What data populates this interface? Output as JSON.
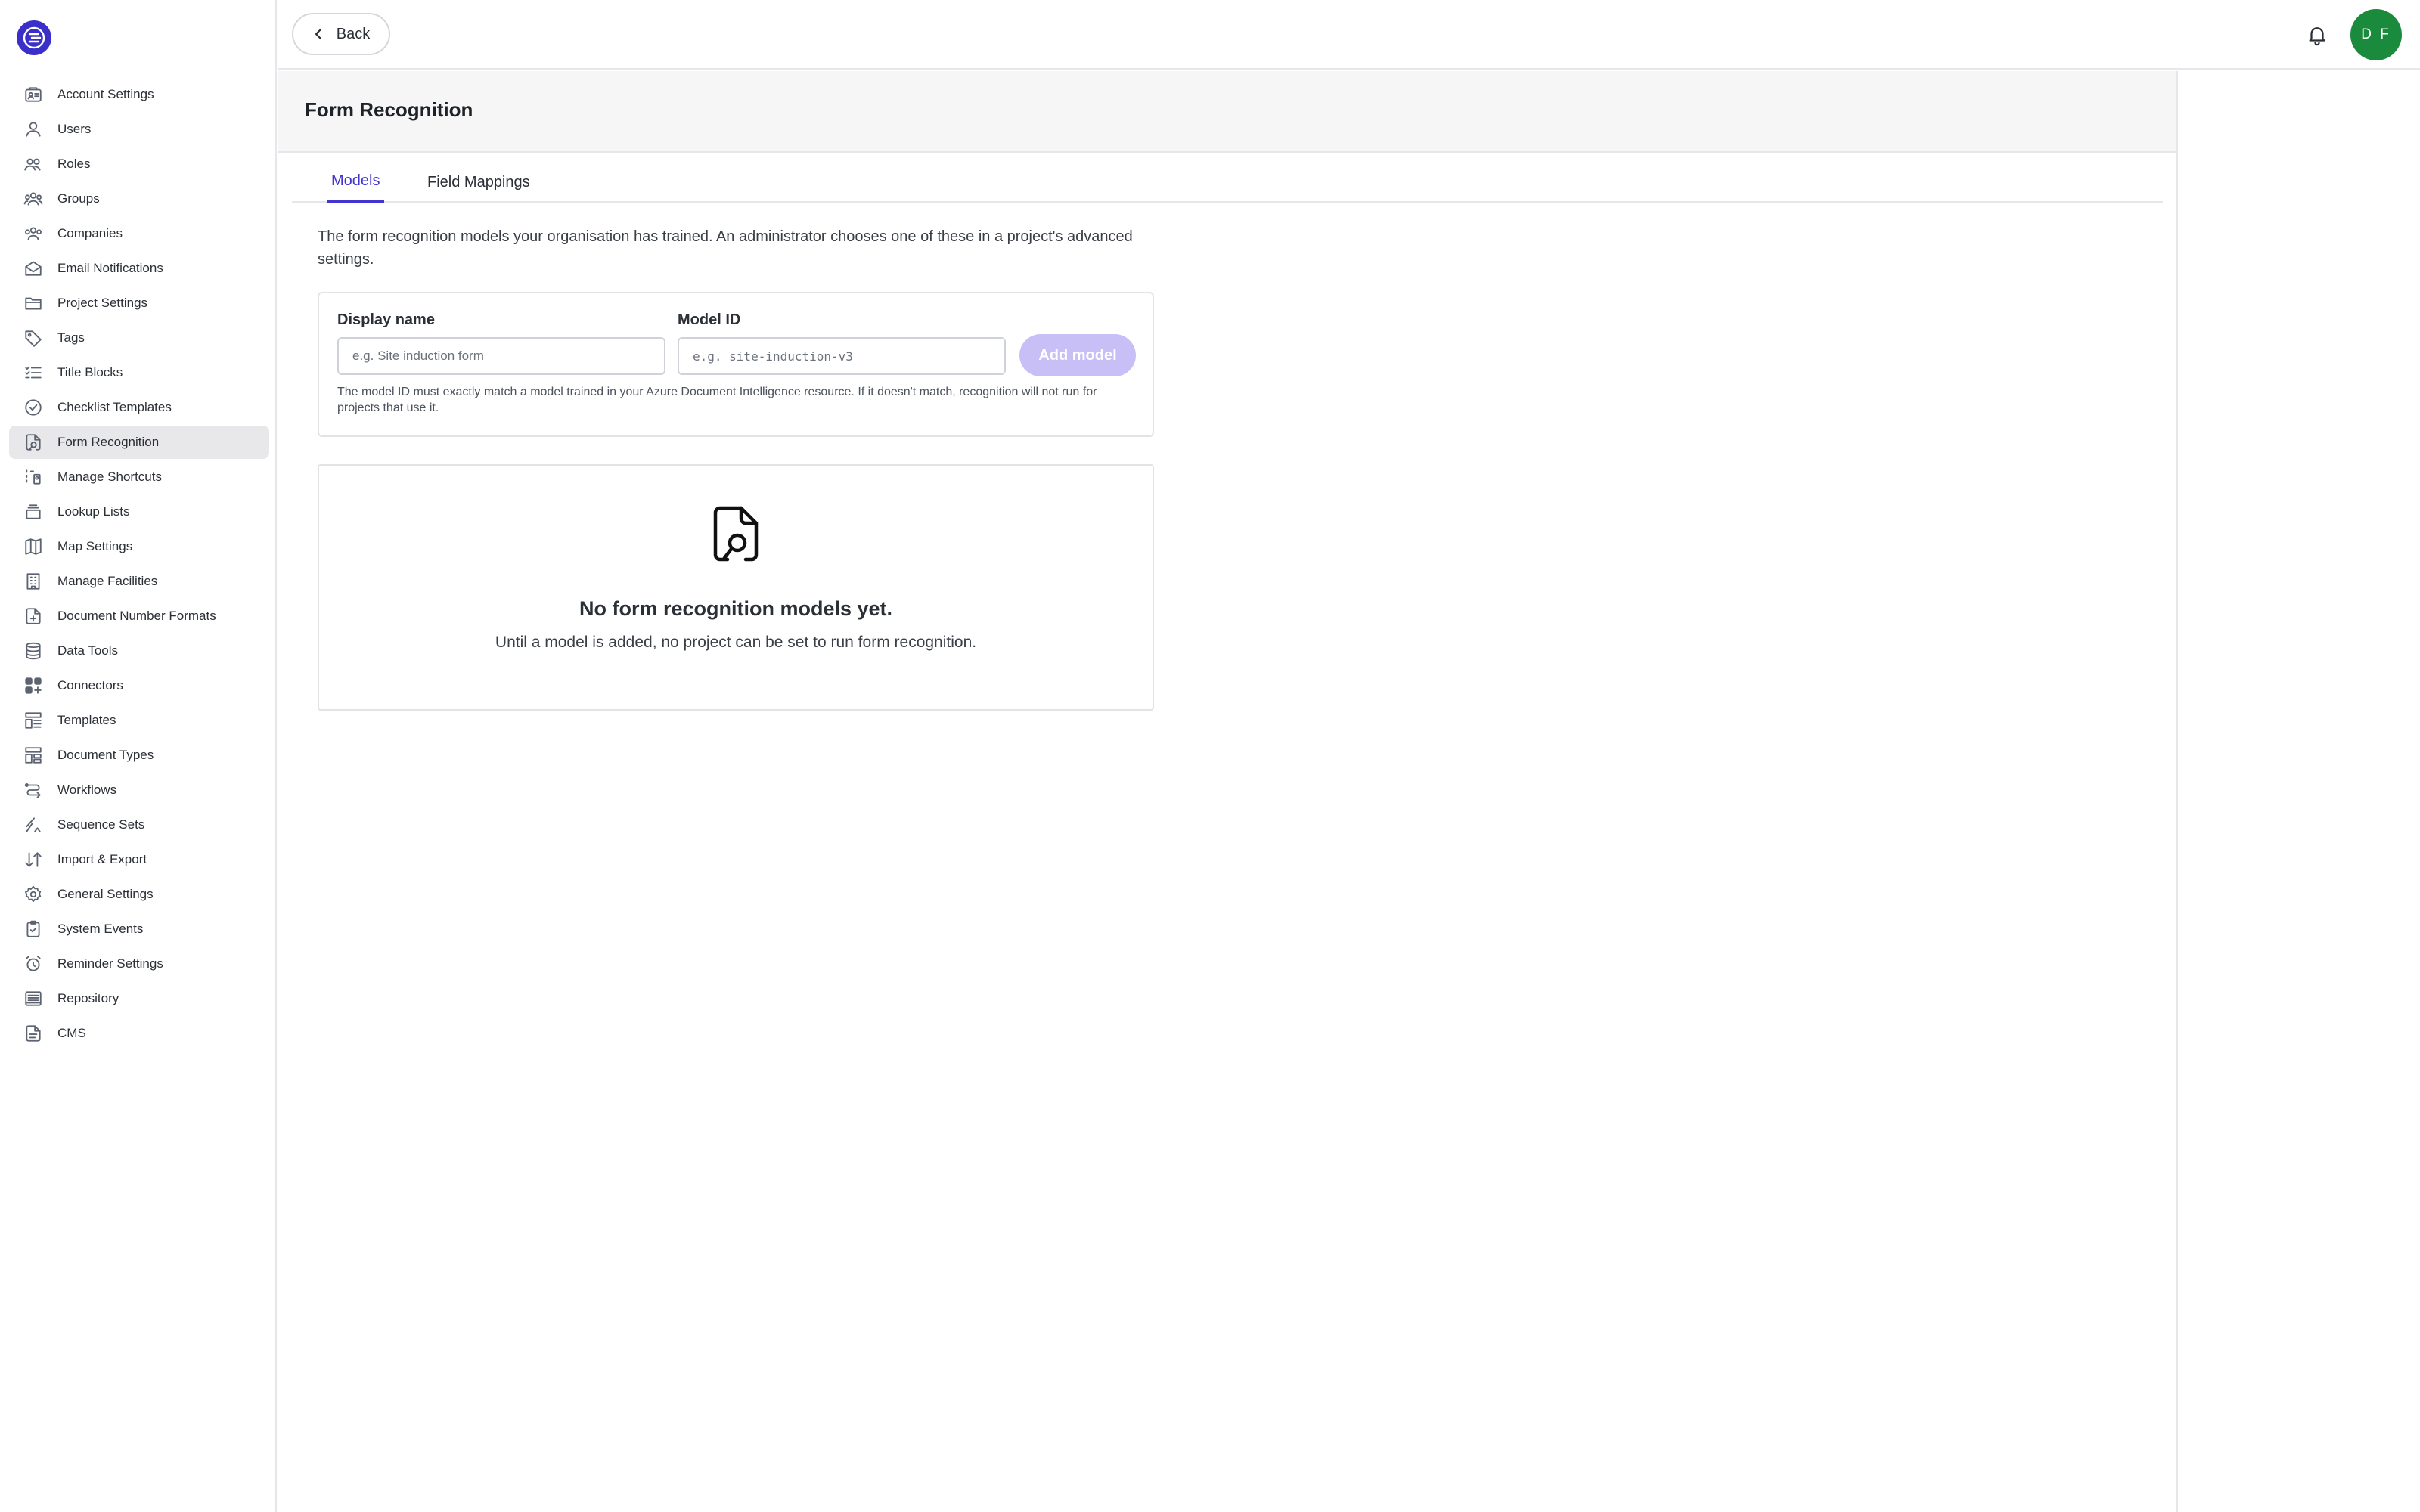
{
  "sidebar": {
    "items": [
      {
        "label": "Account Settings",
        "icon": "account-settings-icon"
      },
      {
        "label": "Users",
        "icon": "user-icon"
      },
      {
        "label": "Roles",
        "icon": "roles-icon"
      },
      {
        "label": "Groups",
        "icon": "groups-icon"
      },
      {
        "label": "Companies",
        "icon": "companies-icon"
      },
      {
        "label": "Email Notifications",
        "icon": "envelope-icon"
      },
      {
        "label": "Project Settings",
        "icon": "folder-icon"
      },
      {
        "label": "Tags",
        "icon": "tag-icon"
      },
      {
        "label": "Title Blocks",
        "icon": "list-icon"
      },
      {
        "label": "Checklist Templates",
        "icon": "check-circle-icon"
      },
      {
        "label": "Form Recognition",
        "icon": "file-search-icon",
        "active": true
      },
      {
        "label": "Manage Shortcuts",
        "icon": "shortcuts-icon"
      },
      {
        "label": "Lookup Lists",
        "icon": "stack-icon"
      },
      {
        "label": "Map Settings",
        "icon": "map-icon"
      },
      {
        "label": "Manage Facilities",
        "icon": "building-icon"
      },
      {
        "label": "Document Number Formats",
        "icon": "file-plus-icon"
      },
      {
        "label": "Data Tools",
        "icon": "database-icon"
      },
      {
        "label": "Connectors",
        "icon": "connectors-icon"
      },
      {
        "label": "Templates",
        "icon": "templates-icon"
      },
      {
        "label": "Document Types",
        "icon": "document-types-icon"
      },
      {
        "label": "Workflows",
        "icon": "workflow-icon"
      },
      {
        "label": "Sequence Sets",
        "icon": "sequence-icon"
      },
      {
        "label": "Import & Export",
        "icon": "import-export-icon"
      },
      {
        "label": "General Settings",
        "icon": "gear-icon"
      },
      {
        "label": "System Events",
        "icon": "clipboard-check-icon"
      },
      {
        "label": "Reminder Settings",
        "icon": "alarm-icon"
      },
      {
        "label": "Repository",
        "icon": "repository-icon"
      },
      {
        "label": "CMS",
        "icon": "file-text-icon"
      }
    ]
  },
  "topbar": {
    "back_label": "Back",
    "avatar_initials": "D F"
  },
  "page": {
    "title": "Form Recognition",
    "tabs": [
      {
        "label": "Models",
        "active": true
      },
      {
        "label": "Field Mappings",
        "active": false
      }
    ],
    "intro": "The form recognition models your organisation has trained. An administrator chooses one of these in a project's advanced settings."
  },
  "form": {
    "display_name_label": "Display name",
    "display_name_placeholder": "e.g. Site induction form",
    "model_id_label": "Model ID",
    "model_id_placeholder": "e.g. site-induction-v3",
    "add_button": "Add model",
    "help_text": "The model ID must exactly match a model trained in your Azure Document Intelligence resource. If it doesn't match, recognition will not run for projects that use it."
  },
  "empty_state": {
    "title": "No form recognition models yet.",
    "subtitle": "Until a model is added, no project can be set to run form recognition."
  },
  "colors": {
    "accent": "#4434d0",
    "logo": "#3b2fc9",
    "avatar": "#1a8a3c",
    "add_button_disabled": "#c8bff7"
  }
}
